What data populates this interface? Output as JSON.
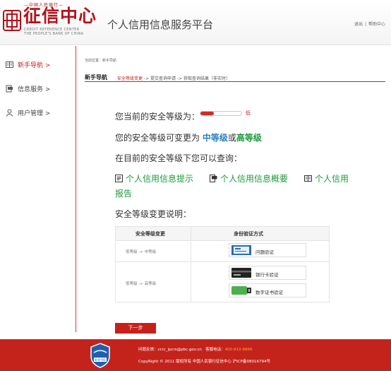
{
  "header": {
    "logo_top": "—中国人民银行—",
    "logo_main": "征信中心",
    "logo_en_line1": "CREDIT REFERENCE CENTER",
    "logo_en_line2": "THE PEOPLE'S BANK OF CHINA",
    "platform_title": "个人信用信息服务平台",
    "logout_label": "退出",
    "separator": "|",
    "help_label": "帮助中心"
  },
  "sidebar": {
    "items": [
      {
        "label": "新手导航 >",
        "icon": "book-icon",
        "active": true
      },
      {
        "label": "信息服务 >",
        "icon": "document-icon",
        "active": false
      },
      {
        "label": "用户管理 >",
        "icon": "user-icon",
        "active": false
      }
    ]
  },
  "breadcrumb": "当前位置：新手导航",
  "steps": {
    "title": "新手导航",
    "current_step": "安全等级变更",
    "rest": " -> 提交查询申请 -> 获取查询结果（非实时）"
  },
  "security": {
    "current_level_label": "您当前的安全等级为：",
    "level_value": "低",
    "level_fraction": 0.33,
    "level_color": "#d32a24",
    "upgrade_prefix": "您的安全等级可变更为 ",
    "upgrade_mid": "中等级",
    "upgrade_or": "或",
    "upgrade_high": "高等级",
    "query_intro": "在目前的安全等级下您可以查询：",
    "query_links": [
      {
        "label": "个人信用信息提示",
        "icon": "note-icon"
      },
      {
        "label": "个人信用信息概要",
        "icon": "clipboard-icon"
      },
      {
        "label": "个人信用",
        "icon": "book-icon"
      }
    ],
    "query_wrap": "报告",
    "change_desc": "安全等级变更说明："
  },
  "table": {
    "headers": [
      "安全等级变更",
      "身份验证方式"
    ],
    "rows": [
      {
        "change": "低等级 -> 中等级",
        "methods": [
          {
            "label": "问题验证",
            "icon": "question-card-icon",
            "badge": "问题1"
          }
        ]
      },
      {
        "change": "低等级 -> 高等级",
        "methods": [
          {
            "label": "银行卡验证",
            "icon": "bank-card-icon"
          },
          {
            "label": "数字证书验证",
            "icon": "usb-key-icon"
          }
        ]
      }
    ]
  },
  "next_button": "下一步",
  "footer": {
    "feedback": "问题反馈：ccrc_ipcrs@pbc.gov.cn",
    "hotline_label": "客服电话：",
    "hotline": "400-810-8866",
    "copyright": "CopyRight © 2011  版权所有  中国人民银行征信中心  沪ICP备08016794号",
    "badge_text": "安全可信"
  },
  "colors": {
    "accent": "#c6211c",
    "footer_bg": "#c4231c",
    "blue": "#2a7fc4",
    "green": "#1e9a3c"
  }
}
